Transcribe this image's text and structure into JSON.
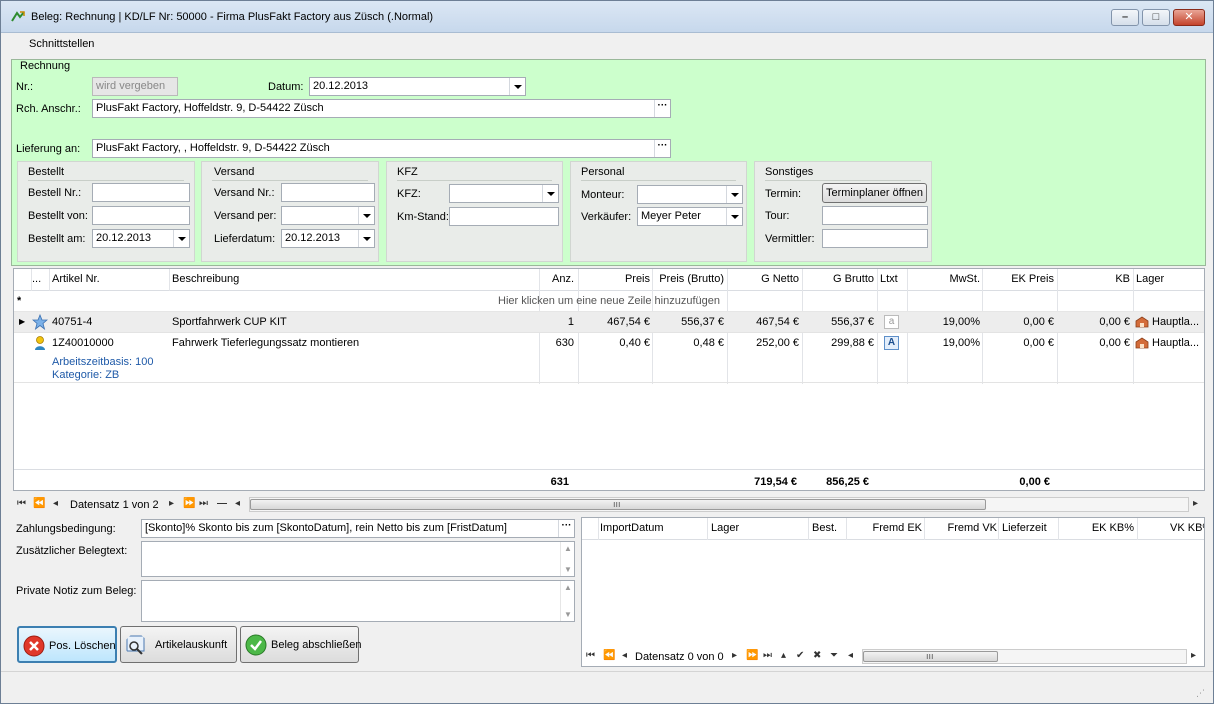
{
  "window": {
    "title": "Beleg: Rechnung | KD/LF Nr: 50000 - Firma PlusFakt Factory  aus Züsch (.Normal)",
    "minimize_glyph": "–",
    "maximize_glyph": "□",
    "close_glyph": "✕"
  },
  "menu": {
    "items": [
      "Schnittstellen"
    ]
  },
  "rechnung": {
    "group_title": "Rechnung",
    "nr_label": "Nr.:",
    "nr_value": "wird vergeben",
    "datum_label": "Datum:",
    "datum_value": "20.12.2013",
    "rch_label": "Rch. Anschr.:",
    "rch_value": "PlusFakt Factory,  Hoffeldstr. 9,  D-54422 Züsch",
    "lieferung_label": "Lieferung an:",
    "lieferung_value": "PlusFakt Factory,  ,  Hoffeldstr. 9,  D-54422 Züsch"
  },
  "bestellt": {
    "title": "Bestellt",
    "nr_label": "Bestell Nr.:",
    "nr_value": "",
    "von_label": "Bestellt von:",
    "von_value": "",
    "am_label": "Bestellt am:",
    "am_value": "20.12.2013"
  },
  "versand": {
    "title": "Versand",
    "nr_label": "Versand Nr.:",
    "nr_value": "",
    "per_label": "Versand per:",
    "per_value": "",
    "datum_label": "Lieferdatum:",
    "datum_value": "20.12.2013"
  },
  "kfz": {
    "title": "KFZ",
    "kfz_label": "KFZ:",
    "kfz_value": "",
    "km_label": "Km-Stand:",
    "km_value": ""
  },
  "personal": {
    "title": "Personal",
    "monteur_label": "Monteur:",
    "monteur_value": "",
    "verkaeufer_label": "Verkäufer:",
    "verkaeufer_value": "Meyer Peter"
  },
  "sonstiges": {
    "title": "Sonstiges",
    "termin_label": "Termin:",
    "termin_button": "Terminplaner öffnen",
    "tour_label": "Tour:",
    "tour_value": "",
    "vermittler_label": "Vermittler:",
    "vermittler_value": ""
  },
  "positions": {
    "columns": [
      "...",
      "Artikel Nr.",
      "Beschreibung",
      "Anz.",
      "Preis",
      "Preis (Brutto)",
      "G Netto",
      "G Brutto",
      "Ltxt",
      "MwSt.",
      "EK Preis",
      "KB",
      "Lager"
    ],
    "new_row_marker": "*",
    "new_row_hint": "Hier klicken um eine neue Zeile hinzuzufügen",
    "rows": [
      {
        "artikel": "40751-4",
        "beschreibung": "Sportfahrwerk CUP KIT",
        "anz": "1",
        "preis": "467,54 €",
        "brutto": "556,37 €",
        "gnetto": "467,54 €",
        "gbrutto": "556,37 €",
        "ltxt": "a",
        "mwst": "19,00%",
        "ek": "0,00 €",
        "kb": "0,00 €",
        "lager": "Hauptla..."
      },
      {
        "artikel": "1Z40010000",
        "beschreibung": "Fahrwerk Tieferlegungssatz montieren",
        "anz": "630",
        "preis": "0,40 €",
        "brutto": "0,48 €",
        "gnetto": "252,00 €",
        "gbrutto": "299,88 €",
        "ltxt": "A",
        "mwst": "19,00%",
        "ek": "0,00 €",
        "kb": "0,00 €",
        "lager": "Hauptla..."
      }
    ],
    "detail_lines": [
      "Arbeitszeitbasis: 100",
      "Kategorie: ZB"
    ],
    "totals": {
      "anz": "631",
      "gnetto": "719,54 €",
      "gbrutto": "856,25 €",
      "ek": "0,00 €"
    },
    "nav_text": "Datensatz 1 von 2"
  },
  "footer": {
    "zahlung_label": "Zahlungsbedingung:",
    "zahlung_value": "[Skonto]% Skonto bis zum [SkontoDatum], rein Netto bis zum  [FristDatum]",
    "belegtext_label": "Zusätzlicher Belegtext:",
    "notiz_label": "Private Notiz zum Beleg:"
  },
  "actions": {
    "delete": "Pos. Löschen",
    "info": "Artikelauskunft",
    "finish": "Beleg abschließen"
  },
  "import": {
    "columns": [
      "ImportDatum",
      "Lager",
      "Best.",
      "Fremd EK",
      "Fremd VK",
      "Lieferzeit",
      "EK KB%",
      "VK KB%"
    ],
    "nav_text": "Datensatz 0 von 0"
  }
}
